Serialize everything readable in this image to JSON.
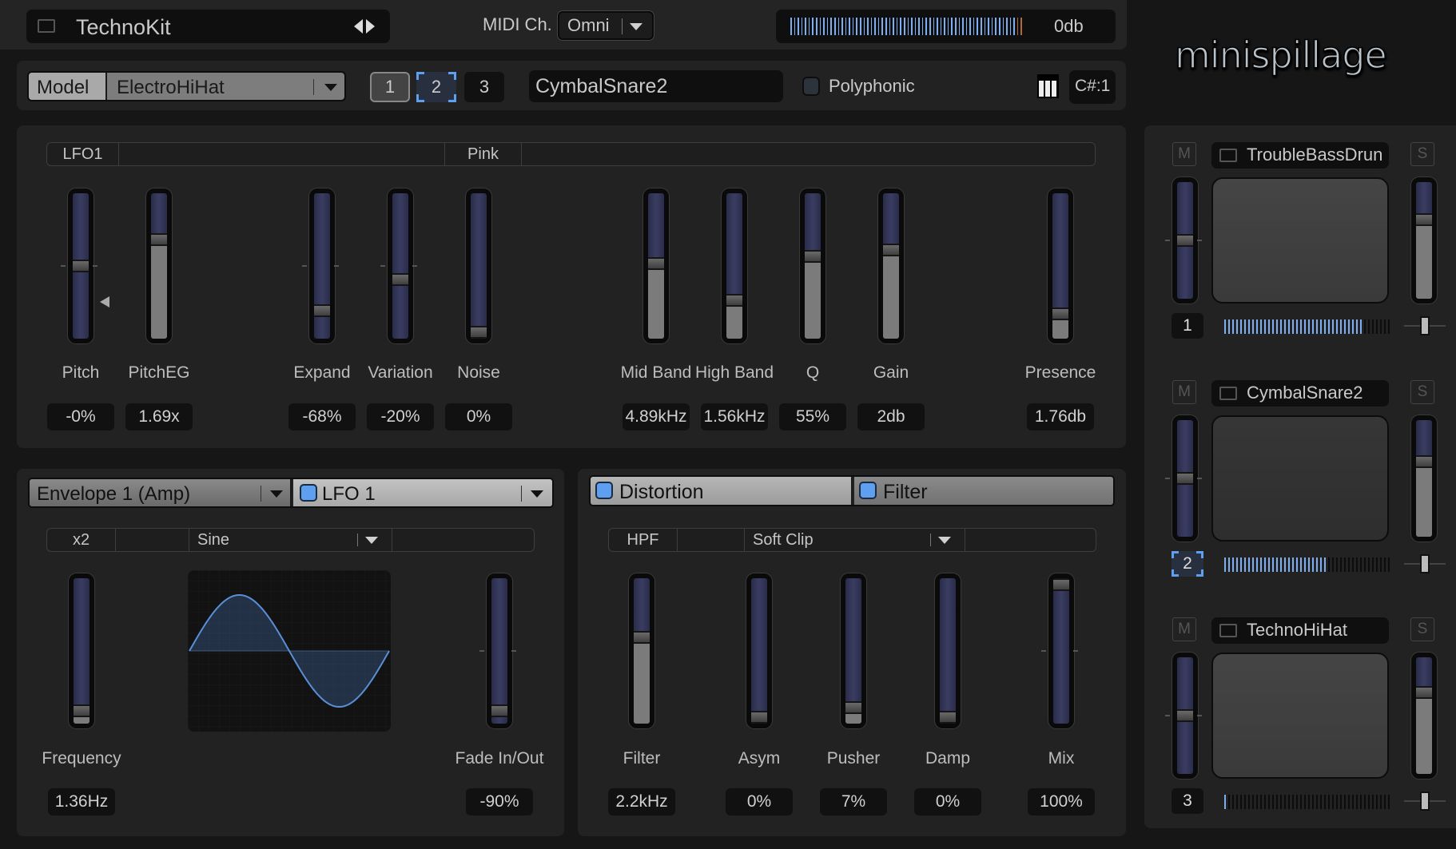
{
  "header": {
    "kit_name": "TechnoKit",
    "midi_label": "MIDI Ch.",
    "midi_channel": "Omni",
    "output_level": "0db",
    "logo": "minispillage"
  },
  "drum_row": {
    "model_label": "Model",
    "model_value": "ElectroHiHat",
    "slots": [
      "1",
      "2",
      "3"
    ],
    "selected_slot": "2",
    "drum_name": "CymbalSnare2",
    "polyphonic_label": "Polyphonic",
    "polyphonic_checked": false,
    "note": "C#:1"
  },
  "main": {
    "strip": {
      "lfo": "LFO1",
      "noise_type": "Pink"
    },
    "sliders": [
      {
        "label": "Pitch",
        "value": "-0%",
        "position": 0.5,
        "bipolar": true
      },
      {
        "label": "PitchEG",
        "value": "1.69x",
        "position": 0.7
      },
      {
        "label": "Expand",
        "value": "-68%",
        "position": 0.16,
        "bipolar": true
      },
      {
        "label": "Variation",
        "value": "-20%",
        "position": 0.4,
        "bipolar": true
      },
      {
        "label": "Noise",
        "value": "0%",
        "position": 0.0
      },
      {
        "label": "Mid Band",
        "value": "4.89kHz",
        "position": 0.52
      },
      {
        "label": "High Band",
        "value": "1.56kHz",
        "position": 0.24
      },
      {
        "label": "Q",
        "value": "55%",
        "position": 0.57
      },
      {
        "label": "Gain",
        "value": "2db",
        "position": 0.62
      },
      {
        "label": "Presence",
        "value": "1.76db",
        "position": 0.14
      }
    ]
  },
  "mod_panel": {
    "tabs": [
      {
        "label": "Envelope 1 (Amp)",
        "active": false
      },
      {
        "label": "LFO 1",
        "active": true,
        "enabled": true
      }
    ],
    "strip": {
      "multiplier": "x2",
      "waveform": "Sine"
    },
    "sliders": [
      {
        "label": "Frequency",
        "value": "1.36Hz",
        "position": 0.05
      },
      {
        "label": "Fade In/Out",
        "value": "-90%",
        "position": 0.05,
        "bipolar": true
      }
    ]
  },
  "fx_panel": {
    "tabs": [
      {
        "label": "Distortion",
        "active": true,
        "enabled": true
      },
      {
        "label": "Filter",
        "active": false,
        "enabled": true
      }
    ],
    "strip": {
      "filter_type": "HPF",
      "mode": "Soft Clip"
    },
    "sliders": [
      {
        "label": "Filter",
        "value": "2.2kHz",
        "position": 0.6
      },
      {
        "label": "Asym",
        "value": "0%",
        "position": 0.0
      },
      {
        "label": "Pusher",
        "value": "7%",
        "position": 0.07
      },
      {
        "label": "Damp",
        "value": "0%",
        "position": 0.0
      },
      {
        "label": "Mix",
        "value": "100%",
        "position": 1.0,
        "bipolar": true
      }
    ]
  },
  "channels": [
    {
      "name": "TroubleBassDrun",
      "number": "1",
      "mute": "M",
      "solo": "S",
      "pan": 0.5,
      "volume": 0.7,
      "meter": 0.83,
      "selected": false
    },
    {
      "name": "CymbalSnare2",
      "number": "2",
      "mute": "M",
      "solo": "S",
      "pan": 0.5,
      "volume": 0.66,
      "meter": 0.61,
      "selected": true
    },
    {
      "name": "TechnoHiHat",
      "number": "3",
      "mute": "M",
      "solo": "S",
      "pan": 0.5,
      "volume": 0.72,
      "meter": 0.01,
      "selected": false
    }
  ],
  "colors": {
    "accent": "#5ea0ef",
    "track": "#34375a",
    "fill": "#7b7b7b",
    "panel": "#222222"
  }
}
